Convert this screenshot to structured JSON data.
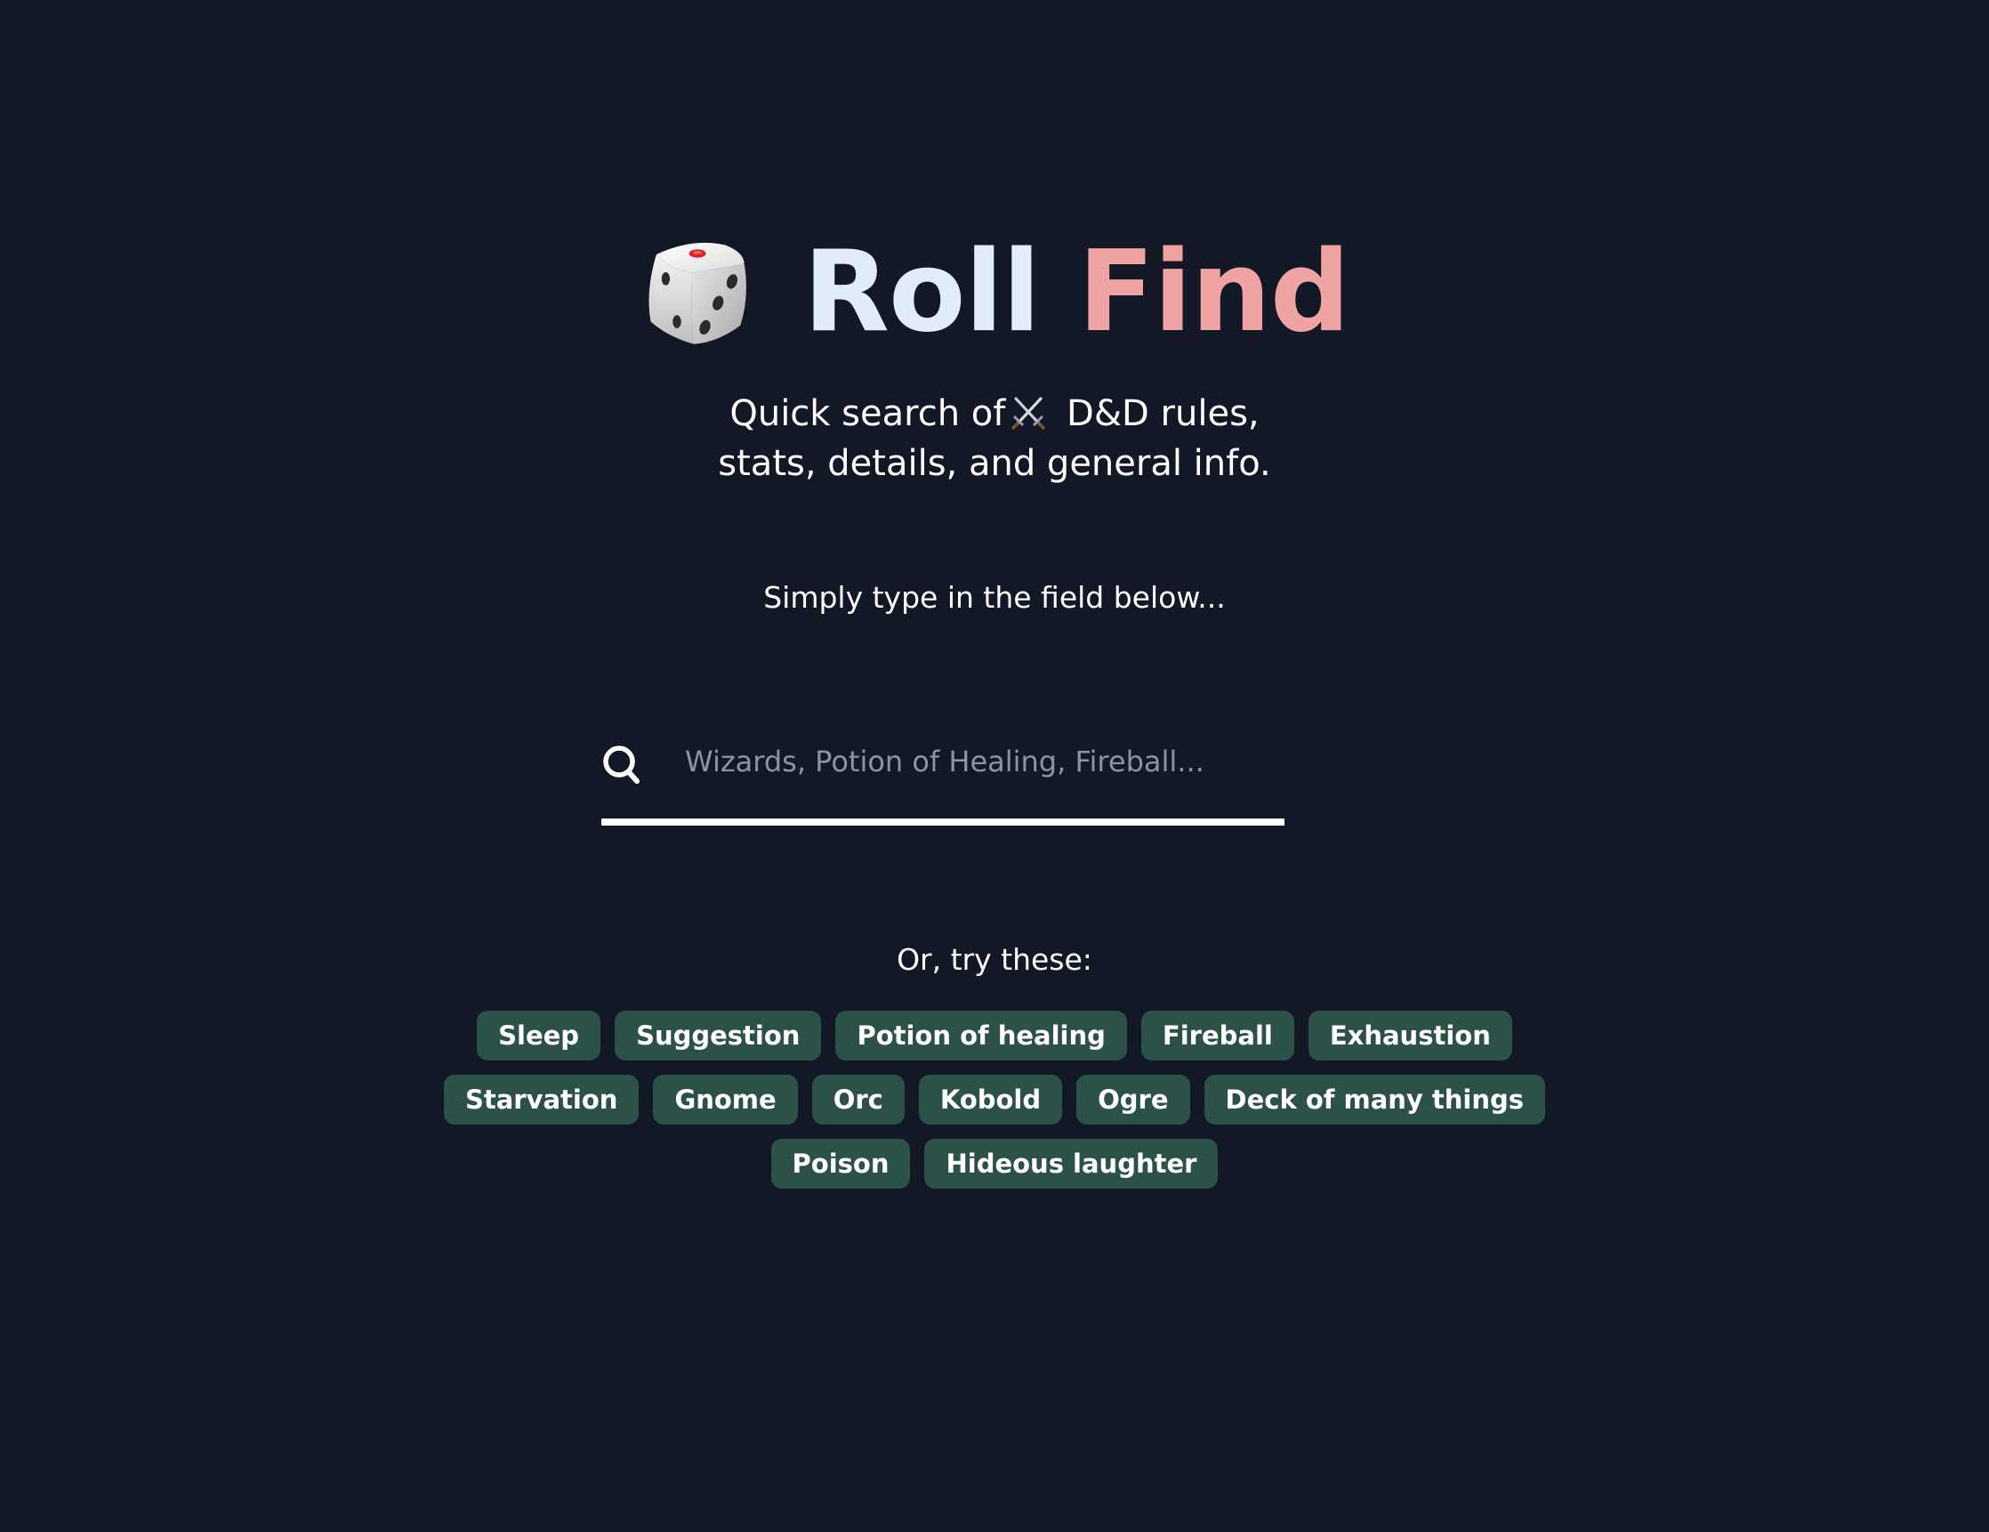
{
  "header": {
    "logo_icon": "game-die-icon",
    "title_part1": "Roll",
    "title_part2": "Find",
    "title_part1_color": "#e3ecfb",
    "title_part2_color": "#f0a3a3"
  },
  "tagline": {
    "line1_before_icon": "Quick search of",
    "inline_icon": "crossed-swords-icon",
    "line1_after_icon": "D&D rules,",
    "line2": "stats, details, and general info."
  },
  "hint": "Simply type in the field below...",
  "search": {
    "icon": "search-icon",
    "placeholder": "Wizards, Potion of Healing, Fireball...",
    "value": ""
  },
  "suggestions": {
    "label": "Or, try these:",
    "chip_color": "#2c5148",
    "rows": [
      [
        "Sleep",
        "Suggestion",
        "Potion of healing",
        "Fireball",
        "Exhaustion"
      ],
      [
        "Starvation",
        "Gnome",
        "Orc",
        "Kobold",
        "Ogre",
        "Deck of many things"
      ],
      [
        "Poison",
        "Hideous laughter"
      ]
    ]
  },
  "colors": {
    "background": "#121826",
    "text": "#ffffff",
    "placeholder": "#8b93a4"
  }
}
